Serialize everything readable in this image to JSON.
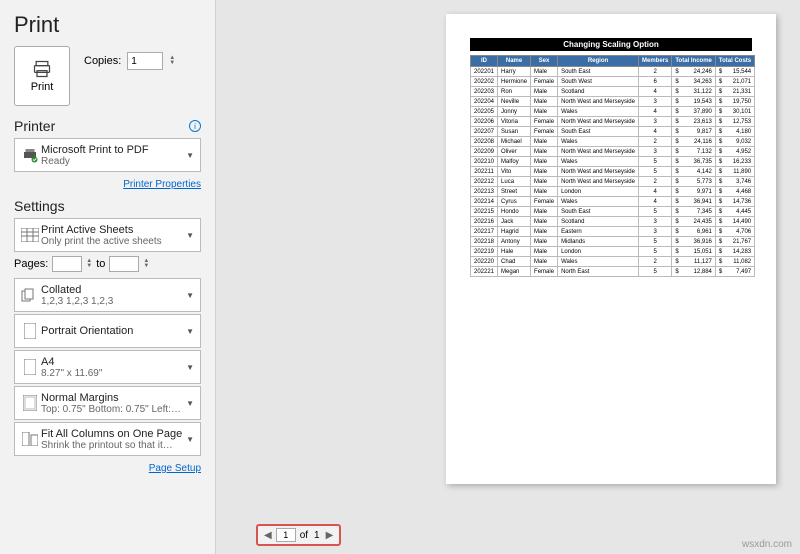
{
  "header": {
    "title": "Print"
  },
  "print": {
    "button_label": "Print",
    "copies_label": "Copies:",
    "copies_value": "1"
  },
  "printer": {
    "section_label": "Printer",
    "name": "Microsoft Print to PDF",
    "status": "Ready",
    "properties_link": "Printer Properties"
  },
  "settings": {
    "section_label": "Settings",
    "print_scope": {
      "line1": "Print Active Sheets",
      "line2": "Only print the active sheets"
    },
    "pages_label": "Pages:",
    "pages_to": "to",
    "collation": {
      "line1": "Collated",
      "line2": "1,2,3   1,2,3   1,2,3"
    },
    "orientation": {
      "line1": "Portrait Orientation",
      "line2": ""
    },
    "paper": {
      "line1": "A4",
      "line2": "8.27\" x 11.69\""
    },
    "margins": {
      "line1": "Normal Margins",
      "line2": "Top: 0.75\" Bottom: 0.75\" Left:…"
    },
    "scaling": {
      "line1": "Fit All Columns on One Page",
      "line2": "Shrink the printout so that it…"
    },
    "page_setup_link": "Page Setup"
  },
  "nav": {
    "current": "1",
    "of_label": "of",
    "total": "1"
  },
  "preview": {
    "title_bar": "Changing Scaling Option",
    "columns": [
      "ID",
      "Name",
      "Sex",
      "Region",
      "Members",
      "Total Income",
      "Total Costs"
    ],
    "rows": [
      {
        "id": "202201",
        "name": "Harry",
        "sex": "Male",
        "region": "South East",
        "members": "2",
        "income": "24,246",
        "costs": "15,544"
      },
      {
        "id": "202202",
        "name": "Hermione",
        "sex": "Female",
        "region": "South West",
        "members": "6",
        "income": "34,263",
        "costs": "21,071"
      },
      {
        "id": "202203",
        "name": "Ron",
        "sex": "Male",
        "region": "Scotland",
        "members": "4",
        "income": "31,122",
        "costs": "21,331"
      },
      {
        "id": "202204",
        "name": "Neville",
        "sex": "Male",
        "region": "North West and Merseyside",
        "members": "3",
        "income": "19,543",
        "costs": "19,750"
      },
      {
        "id": "202205",
        "name": "Jonny",
        "sex": "Male",
        "region": "Wales",
        "members": "4",
        "income": "37,890",
        "costs": "30,101"
      },
      {
        "id": "202206",
        "name": "Vitoria",
        "sex": "Female",
        "region": "North West and Merseyside",
        "members": "3",
        "income": "23,613",
        "costs": "12,753"
      },
      {
        "id": "202207",
        "name": "Susan",
        "sex": "Female",
        "region": "South East",
        "members": "4",
        "income": "9,817",
        "costs": "4,180"
      },
      {
        "id": "202208",
        "name": "Michael",
        "sex": "Male",
        "region": "Wales",
        "members": "2",
        "income": "24,116",
        "costs": "9,032"
      },
      {
        "id": "202209",
        "name": "Oliver",
        "sex": "Male",
        "region": "North West and Merseyside",
        "members": "3",
        "income": "7,132",
        "costs": "4,952"
      },
      {
        "id": "202210",
        "name": "Malfoy",
        "sex": "Male",
        "region": "Wales",
        "members": "5",
        "income": "36,735",
        "costs": "16,233"
      },
      {
        "id": "202211",
        "name": "Vito",
        "sex": "Male",
        "region": "North West and Merseyside",
        "members": "5",
        "income": "4,142",
        "costs": "11,890"
      },
      {
        "id": "202212",
        "name": "Luca",
        "sex": "Male",
        "region": "North West and Merseyside",
        "members": "2",
        "income": "5,773",
        "costs": "3,746"
      },
      {
        "id": "202213",
        "name": "Street",
        "sex": "Male",
        "region": "London",
        "members": "4",
        "income": "9,971",
        "costs": "4,468"
      },
      {
        "id": "202214",
        "name": "Cyrus",
        "sex": "Female",
        "region": "Wales",
        "members": "4",
        "income": "36,941",
        "costs": "14,736"
      },
      {
        "id": "202215",
        "name": "Hondo",
        "sex": "Male",
        "region": "South East",
        "members": "5",
        "income": "7,345",
        "costs": "4,445"
      },
      {
        "id": "202216",
        "name": "Jack",
        "sex": "Male",
        "region": "Scotland",
        "members": "3",
        "income": "24,435",
        "costs": "14,490"
      },
      {
        "id": "202217",
        "name": "Hagrid",
        "sex": "Male",
        "region": "Eastern",
        "members": "3",
        "income": "6,961",
        "costs": "4,706"
      },
      {
        "id": "202218",
        "name": "Antony",
        "sex": "Male",
        "region": "Midlands",
        "members": "5",
        "income": "36,916",
        "costs": "21,767"
      },
      {
        "id": "202219",
        "name": "Hale",
        "sex": "Male",
        "region": "London",
        "members": "5",
        "income": "15,051",
        "costs": "14,283"
      },
      {
        "id": "202220",
        "name": "Chad",
        "sex": "Male",
        "region": "Wales",
        "members": "2",
        "income": "11,127",
        "costs": "11,082"
      },
      {
        "id": "202221",
        "name": "Megan",
        "sex": "Female",
        "region": "North East",
        "members": "5",
        "income": "12,884",
        "costs": "7,497"
      }
    ]
  },
  "watermark": "wsxdn.com"
}
